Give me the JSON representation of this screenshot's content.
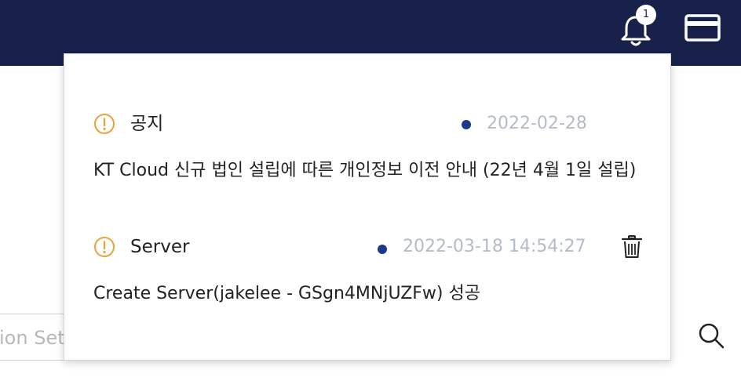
{
  "header": {
    "notification_count": "1",
    "bell_icon": "bell-icon",
    "card_icon": "credit-card-icon"
  },
  "background": {
    "input_text": "ion Sett"
  },
  "notifications": [
    {
      "category": "공지",
      "date": "2022-02-28",
      "message": "KT Cloud 신규 법인 설립에 따른 개인정보 이전 안내 (22년 4월 1일 설립)",
      "icon": "warning-circle-icon"
    },
    {
      "category": "Server",
      "date": "2022-03-18 14:54:27",
      "message": "Create Server(jakelee - GSgn4MNjUZFw) 성공",
      "icon": "warning-circle-icon",
      "action_icon": "trash-icon"
    }
  ],
  "colors": {
    "topbar": "#18214a",
    "warning": "#e8a33d",
    "unread_dot": "#1d3a8a",
    "date_text": "#b5bcc6"
  }
}
